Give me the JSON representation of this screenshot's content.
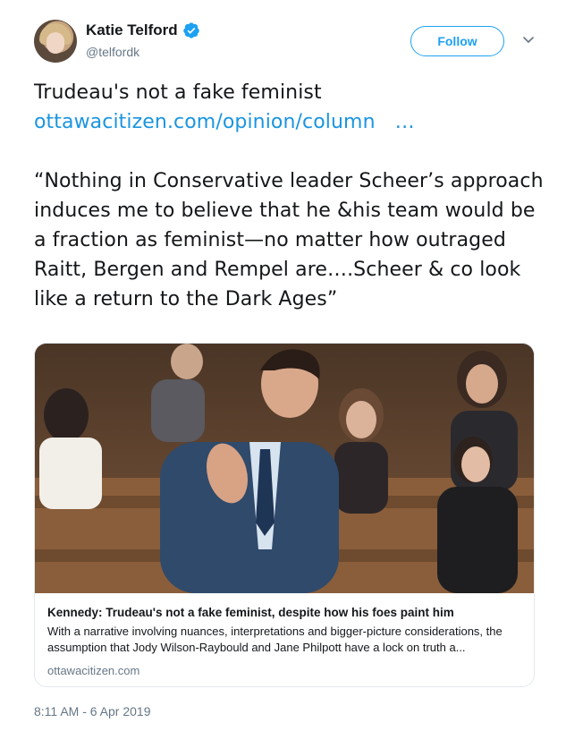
{
  "header": {
    "display_name": "Katie Telford",
    "handle": "@telfordk",
    "follow_label": "Follow"
  },
  "tweet": {
    "line1": "Trudeau's not a fake feminist",
    "link_text": "ottawacitizen.com/opinion/column",
    "link_ellipsis": "…",
    "quote": "“Nothing in Conservative leader Scheer’s approach induces me to believe that he &his team would be a fraction as feminist—no matter how outraged Raitt, Bergen and Rempel are….Scheer & co look like a return to the Dark Ages”"
  },
  "card": {
    "title": "Kennedy: Trudeau's not a fake feminist, despite how his foes paint him",
    "description": "With a narrative involving nuances, interpretations and bigger-picture considerations, the assumption that Jody Wilson-Raybould and Jane Philpott have a lock on truth a...",
    "domain": "ottawacitizen.com"
  },
  "timestamp": "8:11 AM - 6 Apr 2019",
  "colors": {
    "accent": "#1da1f2",
    "link": "#1b95e0",
    "secondary_text": "#657786",
    "border": "#e1e8ed"
  },
  "icons": {
    "verified": "verified-badge-icon",
    "caret": "chevron-down-icon"
  }
}
